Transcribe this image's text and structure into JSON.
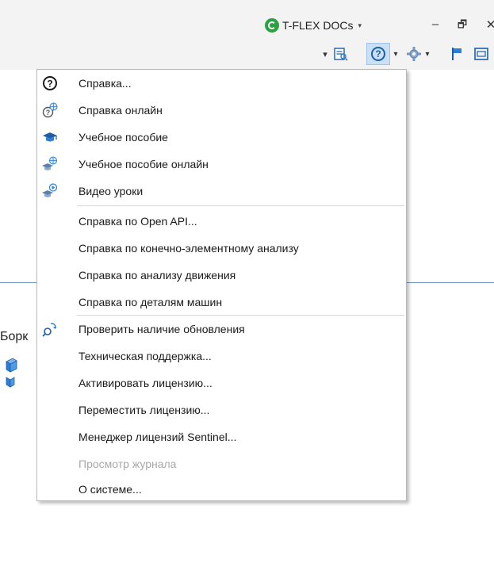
{
  "titlebar": {
    "app_name": "T-FLEX DOCs",
    "app_dropdown_glyph": "▾",
    "minimize": "–",
    "restore": "🗗",
    "close": "✕",
    "logo_color": "#2ea044"
  },
  "toolbar": {
    "overflow_glyph": "▾",
    "help_glyph": "?",
    "dropdown_glyph": "▾",
    "accent": "#1d5ea8",
    "active_bg": "#c9e0f7"
  },
  "workspace": {
    "label": "Борк"
  },
  "menu": {
    "items": [
      {
        "label": "Справка...",
        "icon": "help-circle-icon",
        "enabled": true
      },
      {
        "label": "Справка онлайн",
        "icon": "help-online-icon",
        "enabled": true
      },
      {
        "label": "Учебное пособие",
        "icon": "mortarboard-icon",
        "enabled": true
      },
      {
        "label": "Учебное пособие онлайн",
        "icon": "mortarboard-online-icon",
        "enabled": true
      },
      {
        "label": "Видео уроки",
        "icon": "video-lessons-icon",
        "enabled": true
      },
      {
        "label": "Справка по Open API...",
        "icon": "",
        "enabled": true
      },
      {
        "label": "Справка по конечно-элементному анализу",
        "icon": "",
        "enabled": true
      },
      {
        "label": "Справка по анализу движения",
        "icon": "",
        "enabled": true
      },
      {
        "label": "Справка по деталям машин",
        "icon": "",
        "enabled": true
      },
      {
        "label": "Проверить наличие обновления",
        "icon": "check-updates-icon",
        "enabled": true
      },
      {
        "label": "Техническая поддержка...",
        "icon": "",
        "enabled": true
      },
      {
        "label": "Активировать лицензию...",
        "icon": "",
        "enabled": true
      },
      {
        "label": "Переместить лицензию...",
        "icon": "",
        "enabled": true
      },
      {
        "label": "Менеджер лицензий Sentinel...",
        "icon": "",
        "enabled": true
      },
      {
        "label": "Просмотр журнала",
        "icon": "",
        "enabled": false
      },
      {
        "label": "О системе...",
        "icon": "",
        "enabled": true
      }
    ]
  }
}
